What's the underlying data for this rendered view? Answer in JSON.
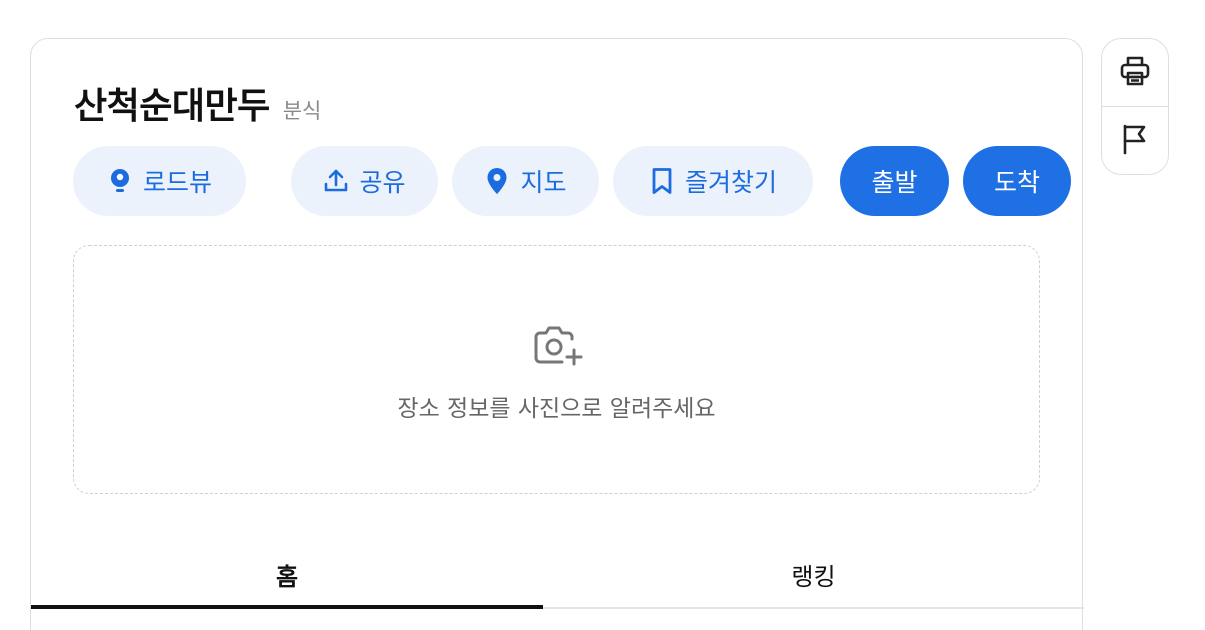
{
  "place": {
    "name": "산척순대만두",
    "category": "분식"
  },
  "actions": [
    {
      "label": "로드뷰",
      "icon": "roadview-icon"
    },
    {
      "label": "공유",
      "icon": "share-icon"
    },
    {
      "label": "지도",
      "icon": "map-pin-icon"
    },
    {
      "label": "즐겨찾기",
      "icon": "bookmark-icon"
    }
  ],
  "route": {
    "departure_label": "출발",
    "arrival_label": "도착"
  },
  "photo_prompt": {
    "text": "장소 정보를 사진으로 알려주세요",
    "icon": "camera-add-icon"
  },
  "tabs": [
    {
      "label": "홈",
      "active": true
    },
    {
      "label": "랭킹",
      "active": false
    }
  ],
  "side_tools": [
    {
      "icon": "print-icon"
    },
    {
      "icon": "flag-icon"
    }
  ],
  "colors": {
    "accent": "#1f6fe5",
    "accent_text": "#1c6ce0",
    "pill_bg": "#ecf2fc",
    "muted_text": "#666666"
  }
}
